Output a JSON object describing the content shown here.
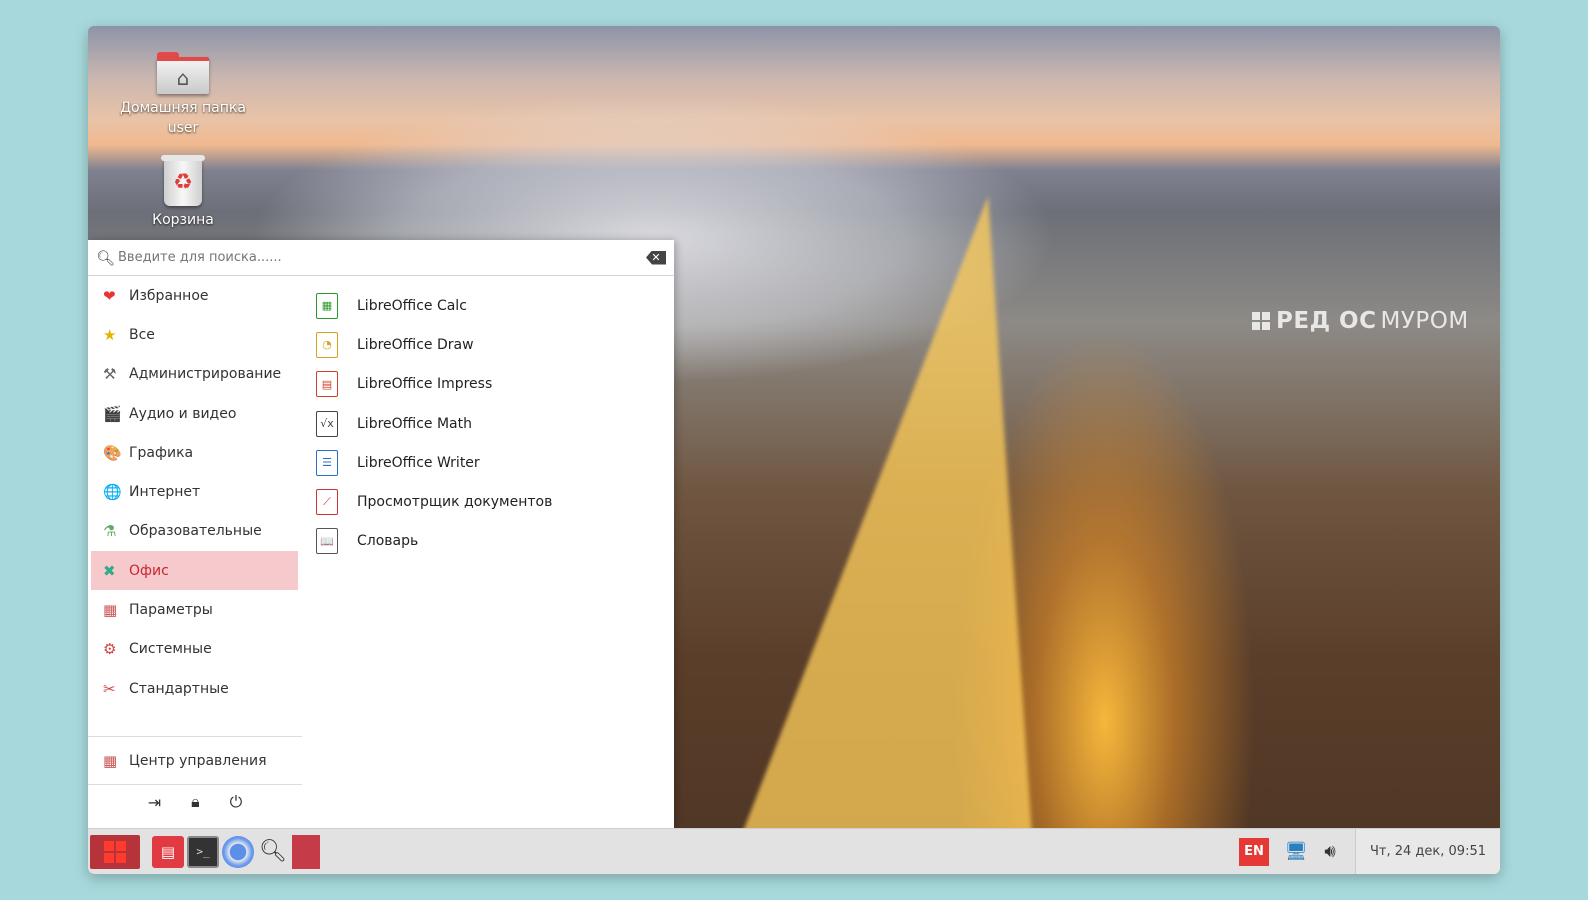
{
  "desktop": {
    "home_label": "Домашняя папка user",
    "trash_label": "Корзина",
    "watermark": {
      "bold": "РЕД ОС",
      "text": " МУРОМ"
    }
  },
  "menu": {
    "search_placeholder": "Введите для поиска......",
    "categories": [
      {
        "label": "Избранное",
        "icon": "heart-icon",
        "glyph": "❤",
        "color": "#e33"
      },
      {
        "label": "Все",
        "icon": "star-icon",
        "glyph": "★",
        "color": "#e7b400"
      },
      {
        "label": "Администрирование",
        "icon": "tools-icon",
        "glyph": "⚒",
        "color": "#666"
      },
      {
        "label": "Аудио и видео",
        "icon": "film-icon",
        "glyph": "🎬",
        "color": "#444"
      },
      {
        "label": "Графика",
        "icon": "palette-icon",
        "glyph": "🎨",
        "color": "#b44"
      },
      {
        "label": "Интернет",
        "icon": "globe-icon",
        "glyph": "🌐",
        "color": "#2a7"
      },
      {
        "label": "Образовательные",
        "icon": "education-icon",
        "glyph": "⚗",
        "color": "#6a6"
      },
      {
        "label": "Офис",
        "icon": "office-icon",
        "glyph": "✖",
        "color": "#3a8"
      },
      {
        "label": "Параметры",
        "icon": "settings-icon",
        "glyph": "▦",
        "color": "#c55"
      },
      {
        "label": "Системные",
        "icon": "system-icon",
        "glyph": "⚙",
        "color": "#c44"
      },
      {
        "label": "Стандартные",
        "icon": "accessories-icon",
        "glyph": "✂",
        "color": "#c44"
      }
    ],
    "selected_category": "Офис",
    "control_center": "Центр управления",
    "apps": [
      {
        "label": "LibreOffice Calc",
        "icon": "libreoffice-calc-icon",
        "glyph": "▦",
        "color": "#2a9a2a"
      },
      {
        "label": "LibreOffice Draw",
        "icon": "libreoffice-draw-icon",
        "glyph": "◔",
        "color": "#d8a020"
      },
      {
        "label": "LibreOffice Impress",
        "icon": "libreoffice-impress-icon",
        "glyph": "▤",
        "color": "#d0402a"
      },
      {
        "label": "LibreOffice Math",
        "icon": "libreoffice-math-icon",
        "glyph": "√x",
        "color": "#444"
      },
      {
        "label": "LibreOffice Writer",
        "icon": "libreoffice-writer-icon",
        "glyph": "☰",
        "color": "#2a6fc0"
      },
      {
        "label": "Просмотрщик документов",
        "icon": "document-viewer-icon",
        "glyph": "⟋",
        "color": "#c33"
      },
      {
        "label": "Словарь",
        "icon": "dictionary-icon",
        "glyph": "📖",
        "color": "#555"
      }
    ]
  },
  "taskbar": {
    "lang": "EN",
    "clock": "Чт, 24 дек, 09:51"
  }
}
